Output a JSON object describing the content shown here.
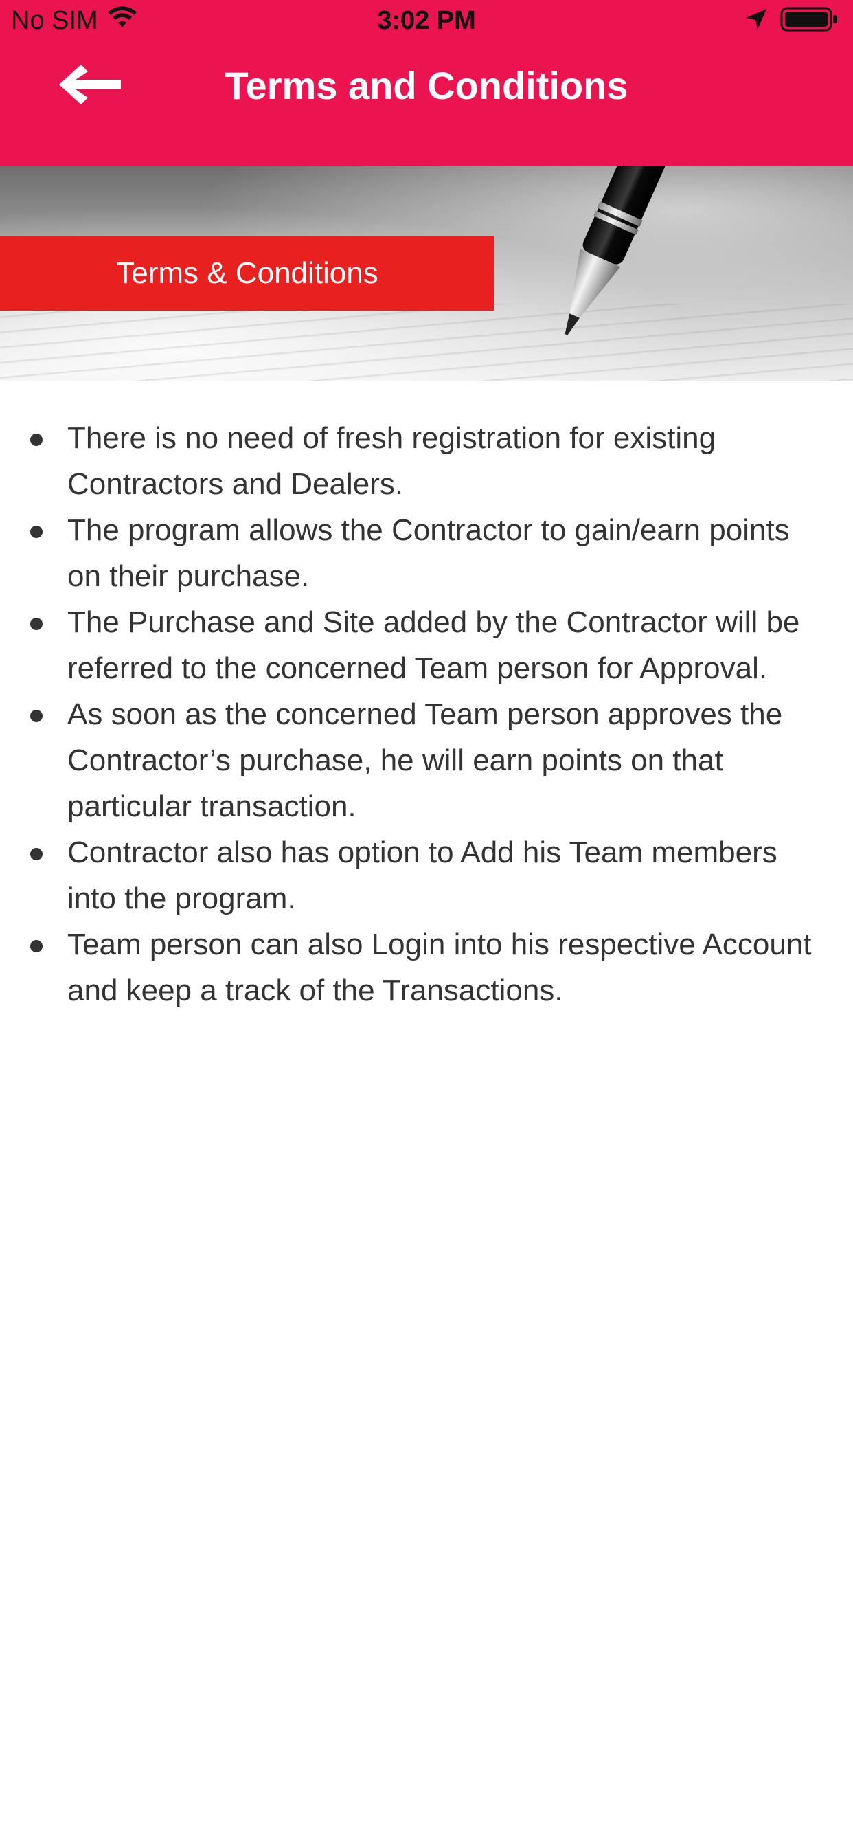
{
  "status_bar": {
    "carrier": "No SIM",
    "time": "3:02 PM",
    "icons": [
      "wifi-icon",
      "location-arrow-icon",
      "battery-icon"
    ]
  },
  "nav": {
    "title": "Terms and Conditions",
    "back_icon": "back-arrow-icon"
  },
  "hero": {
    "label": "Terms & Conditions",
    "image": "pen-on-paper"
  },
  "terms": [
    "There is no need of fresh registration for existing Contractors and Dealers.",
    "The program allows the Contractor to gain/earn points on their purchase.",
    "The Purchase and Site added by the Contractor will be referred to the concerned Team person for Approval.",
    "As soon as the concerned Team person approves the Contractor’s purchase, he will earn points on that particular transaction.",
    "Contractor also has option to Add his Team members into the program.",
    "Team person can also Login into his respective Account and keep a track of the Transactions."
  ],
  "colors": {
    "header": "#ec1450",
    "label_bg": "#e8201f",
    "text": "#333333",
    "background": "#ffffff"
  }
}
